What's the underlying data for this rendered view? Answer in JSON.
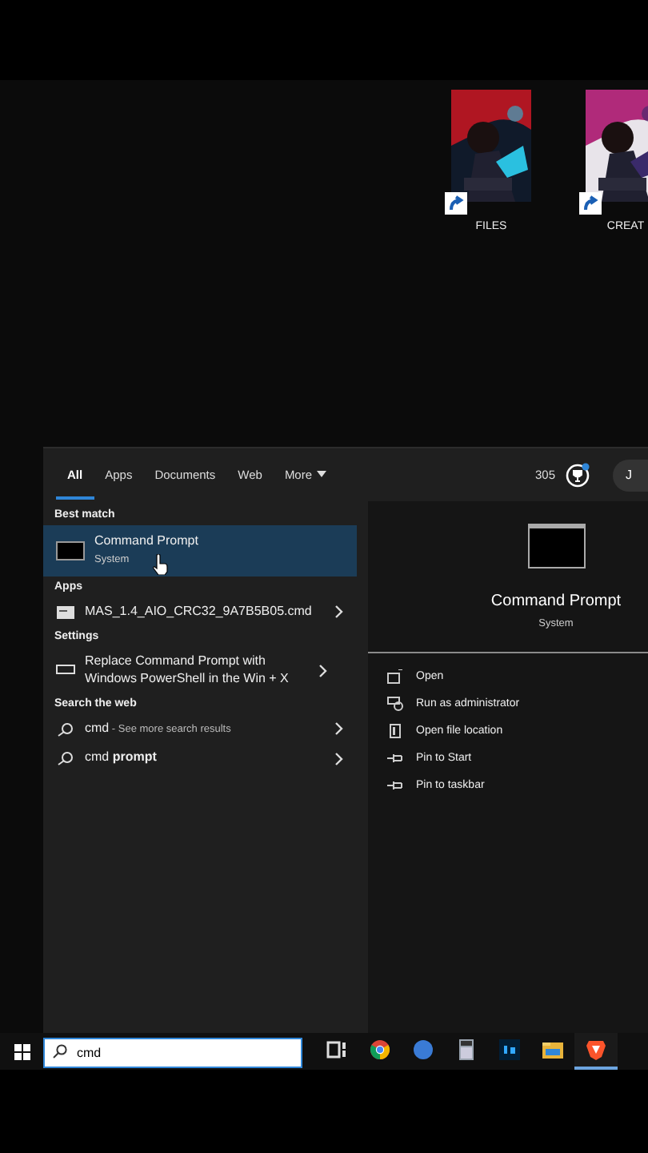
{
  "desktop_icons": [
    {
      "label": "FILES"
    },
    {
      "label": "CREAT"
    }
  ],
  "search_panel": {
    "tabs": [
      {
        "label": "All",
        "selected": true
      },
      {
        "label": "Apps",
        "selected": false
      },
      {
        "label": "Documents",
        "selected": false
      },
      {
        "label": "Web",
        "selected": false
      },
      {
        "label": "More",
        "selected": false,
        "dropdown": true
      }
    ],
    "points": "305",
    "avatar": "J",
    "sections": [
      {
        "heading": "Best match",
        "items": [
          {
            "kind": "best",
            "title": "Command Prompt",
            "subtitle": "System",
            "selected": true
          }
        ]
      },
      {
        "heading": "Apps",
        "items": [
          {
            "kind": "app",
            "title": "MAS_1.4_AIO_CRC32_9A7B5B05.cmd",
            "selected": false
          }
        ]
      },
      {
        "heading": "Settings",
        "items": [
          {
            "kind": "setting",
            "title": "Replace Command Prompt with Windows PowerShell in the Win + X",
            "selected": false
          }
        ]
      },
      {
        "heading": "Search the web",
        "items": [
          {
            "kind": "web",
            "title": "cmd",
            "hint": " - See more search results",
            "selected": false
          },
          {
            "kind": "web",
            "title": "cmd **prompt**",
            "selected": false
          }
        ]
      }
    ],
    "preview": {
      "title": "Command Prompt",
      "subtitle": "System",
      "actions": [
        {
          "kind": "open",
          "label": "Open"
        },
        {
          "kind": "admin",
          "label": "Run as administrator"
        },
        {
          "kind": "folder",
          "label": "Open file location"
        },
        {
          "kind": "pin",
          "label": "Pin to Start"
        },
        {
          "kind": "pin",
          "label": "Pin to taskbar"
        }
      ]
    }
  },
  "taskbar": {
    "search": {
      "value": "cmd"
    },
    "apps": [
      {
        "kind": "taskview",
        "active": false
      },
      {
        "kind": "chrome",
        "active": false
      },
      {
        "kind": "edge",
        "active": false
      },
      {
        "kind": "calculator",
        "active": false
      },
      {
        "kind": "photoshop",
        "active": false
      },
      {
        "kind": "explorer",
        "active": false
      },
      {
        "kind": "brave",
        "active": true
      }
    ]
  }
}
